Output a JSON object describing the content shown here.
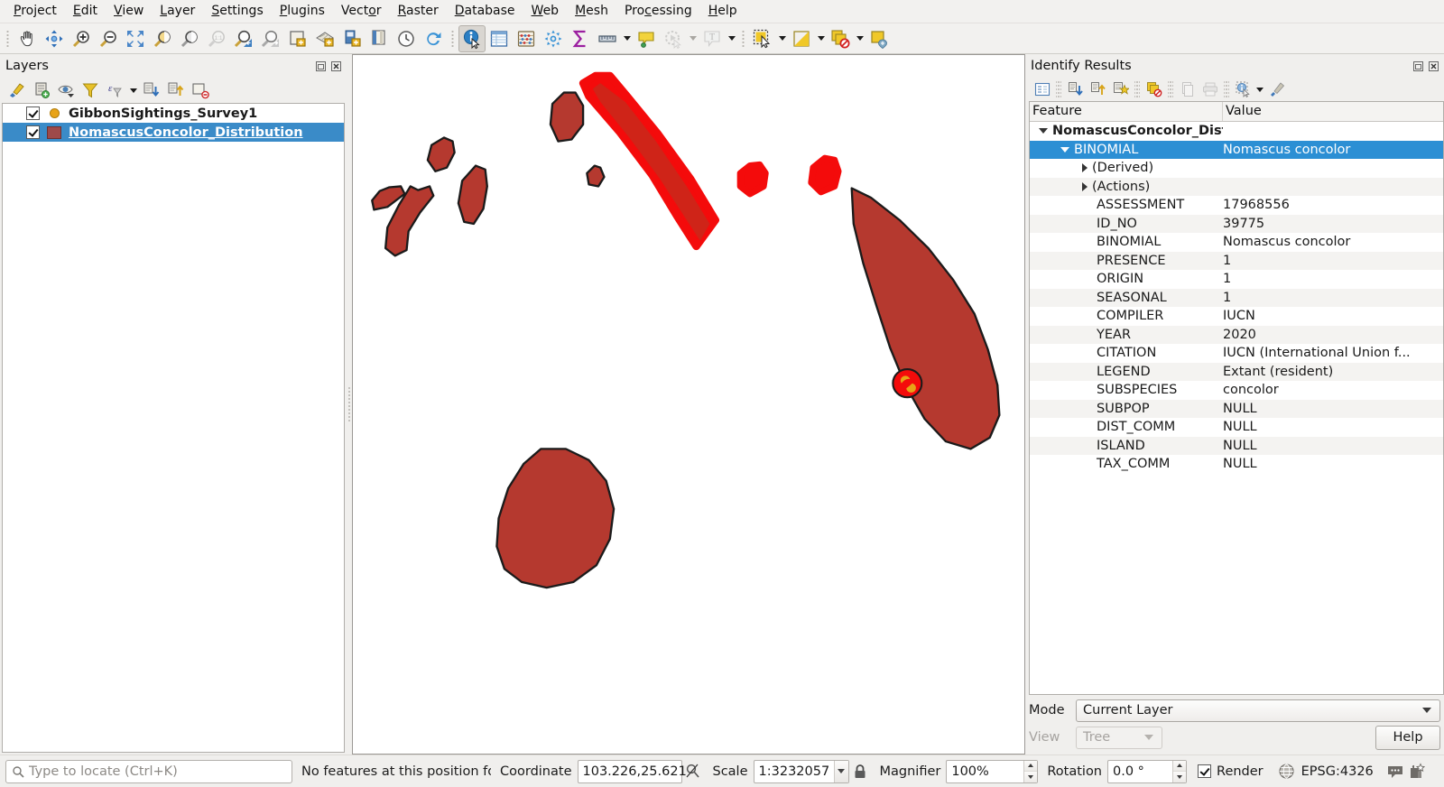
{
  "menubar": {
    "items": [
      {
        "label": "Project",
        "mnemonic": "P"
      },
      {
        "label": "Edit",
        "mnemonic": "E"
      },
      {
        "label": "View",
        "mnemonic": "V"
      },
      {
        "label": "Layer",
        "mnemonic": "L"
      },
      {
        "label": "Settings",
        "mnemonic": "S"
      },
      {
        "label": "Plugins",
        "mnemonic": "P"
      },
      {
        "label": "Vector",
        "mnemonic": "o"
      },
      {
        "label": "Raster",
        "mnemonic": "R"
      },
      {
        "label": "Database",
        "mnemonic": "D"
      },
      {
        "label": "Web",
        "mnemonic": "W"
      },
      {
        "label": "Mesh",
        "mnemonic": "M"
      },
      {
        "label": "Processing",
        "mnemonic": "c"
      },
      {
        "label": "Help",
        "mnemonic": "H"
      }
    ]
  },
  "toolbar": {
    "buttons": [
      {
        "name": "pan-map-icon",
        "tip": "Pan Map"
      },
      {
        "name": "pan-to-selection-icon",
        "tip": "Pan Map to Selection"
      },
      {
        "name": "zoom-in-icon",
        "tip": "Zoom In"
      },
      {
        "name": "zoom-out-icon",
        "tip": "Zoom Out"
      },
      {
        "name": "zoom-full-icon",
        "tip": "Zoom Full"
      },
      {
        "name": "zoom-to-selection-icon",
        "tip": "Zoom to Selection"
      },
      {
        "name": "zoom-to-layer-icon",
        "tip": "Zoom to Layer"
      },
      {
        "name": "zoom-native-icon",
        "tip": "Zoom to Native Resolution (100%)"
      },
      {
        "name": "zoom-last-icon",
        "tip": "Zoom Last"
      },
      {
        "name": "zoom-next-icon",
        "tip": "Zoom Next"
      },
      {
        "name": "new-map-view-icon",
        "tip": "New Map View"
      },
      {
        "name": "new-3d-map-view-icon",
        "tip": "New 3D Map View"
      },
      {
        "name": "new-print-layout-icon",
        "tip": "New Print Layout"
      },
      {
        "name": "style-manager-icon",
        "tip": "Style Manager"
      },
      {
        "name": "temporal-controller-icon",
        "tip": "Temporal Controller Panel"
      },
      {
        "name": "refresh-icon",
        "tip": "Refresh"
      },
      {
        "name": "identify-features-icon",
        "tip": "Identify Features",
        "active": true
      },
      {
        "name": "open-attribute-table-icon",
        "tip": "Open Attribute Table"
      },
      {
        "name": "statistical-summary-icon",
        "tip": "Statistical Summary"
      },
      {
        "name": "processing-toolbox-icon",
        "tip": "Processing Toolbox"
      },
      {
        "name": "sum-icon",
        "tip": "Sum"
      },
      {
        "name": "measure-line-icon",
        "tip": "Measure Line"
      },
      {
        "name": "map-tips-icon",
        "tip": "Show Map Tips"
      },
      {
        "name": "run-feature-action-icon",
        "tip": "Run Feature Action"
      },
      {
        "name": "text-annotation-icon",
        "tip": "Text Annotation"
      },
      {
        "name": "select-features-icon",
        "tip": "Select Features by Area or Single Click"
      },
      {
        "name": "select-by-expression-icon",
        "tip": "Select Features by Expression"
      },
      {
        "name": "deselect-features-icon",
        "tip": "Deselect Features from All Layers"
      },
      {
        "name": "select-value-icon",
        "tip": "Select Value"
      }
    ]
  },
  "layers_panel": {
    "title": "Layers",
    "toolbar": [
      {
        "name": "open-layer-styling-panel-icon"
      },
      {
        "name": "add-group-icon"
      },
      {
        "name": "manage-map-themes-icon"
      },
      {
        "name": "filter-legend-icon"
      },
      {
        "name": "filter-legend-by-expression-icon"
      },
      {
        "name": "expand-all-icon"
      },
      {
        "name": "collapse-all-icon"
      },
      {
        "name": "remove-layer-icon"
      }
    ],
    "layers": [
      {
        "name": "GibbonSightings_Survey1",
        "checked": true,
        "symbol": "point",
        "selected": false
      },
      {
        "name": "NomascusConcolor_Distribution",
        "checked": true,
        "symbol": "polygon",
        "selected": true
      }
    ]
  },
  "identify_panel": {
    "title": "Identify Results",
    "toolbar": [
      {
        "name": "expand-new-icon"
      },
      {
        "name": "expand-all-icon"
      },
      {
        "name": "collapse-all-icon"
      },
      {
        "name": "highlight-all-icon"
      },
      {
        "name": "clear-results-icon"
      },
      {
        "name": "copy-icon",
        "disabled": true
      },
      {
        "name": "print-icon",
        "disabled": true
      },
      {
        "name": "identify-settings-icon"
      },
      {
        "name": "options-icon"
      }
    ],
    "columns": [
      "Feature",
      "Value"
    ],
    "tree": {
      "layer_label": "NomascusConcolor_Distribution",
      "feature_label": "BINOMIAL",
      "feature_value": "Nomascus concolor",
      "groups": [
        "(Derived)",
        "(Actions)"
      ],
      "attributes": [
        {
          "field": "ASSESSMENT",
          "value": "17968556"
        },
        {
          "field": "ID_NO",
          "value": "39775"
        },
        {
          "field": "BINOMIAL",
          "value": "Nomascus concolor"
        },
        {
          "field": "PRESENCE",
          "value": "1"
        },
        {
          "field": "ORIGIN",
          "value": "1"
        },
        {
          "field": "SEASONAL",
          "value": "1"
        },
        {
          "field": "COMPILER",
          "value": "IUCN"
        },
        {
          "field": "YEAR",
          "value": "2020"
        },
        {
          "field": "CITATION",
          "value": "IUCN (International Union f..."
        },
        {
          "field": "LEGEND",
          "value": "Extant (resident)"
        },
        {
          "field": "SUBSPECIES",
          "value": "concolor"
        },
        {
          "field": "SUBPOP",
          "value": "NULL"
        },
        {
          "field": "DIST_COMM",
          "value": "NULL"
        },
        {
          "field": "ISLAND",
          "value": "NULL"
        },
        {
          "field": "TAX_COMM",
          "value": "NULL"
        }
      ]
    },
    "mode_label": "Mode",
    "mode_value": "Current Layer",
    "view_label": "View",
    "view_value": "Tree",
    "help_label": "Help"
  },
  "statusbar": {
    "locate_placeholder": "Type to locate (Ctrl+K)",
    "message": "No features at this position fo",
    "coordinate_label": "Coordinate",
    "coordinate_value": "103.226,25.621",
    "scale_label": "Scale",
    "scale_value": "1:3232057",
    "magnifier_label": "Magnifier",
    "magnifier_value": "100%",
    "rotation_label": "Rotation",
    "rotation_value": "0.0 °",
    "render_label": "Render",
    "render_checked": true,
    "crs_value": "EPSG:4326"
  },
  "map": {
    "fill_color": "#b5392f",
    "stroke_color": "#1b1b1b",
    "highlight_color": "#f40b0b",
    "background": "#ffffff",
    "selected_point_color": "#e8a317"
  }
}
